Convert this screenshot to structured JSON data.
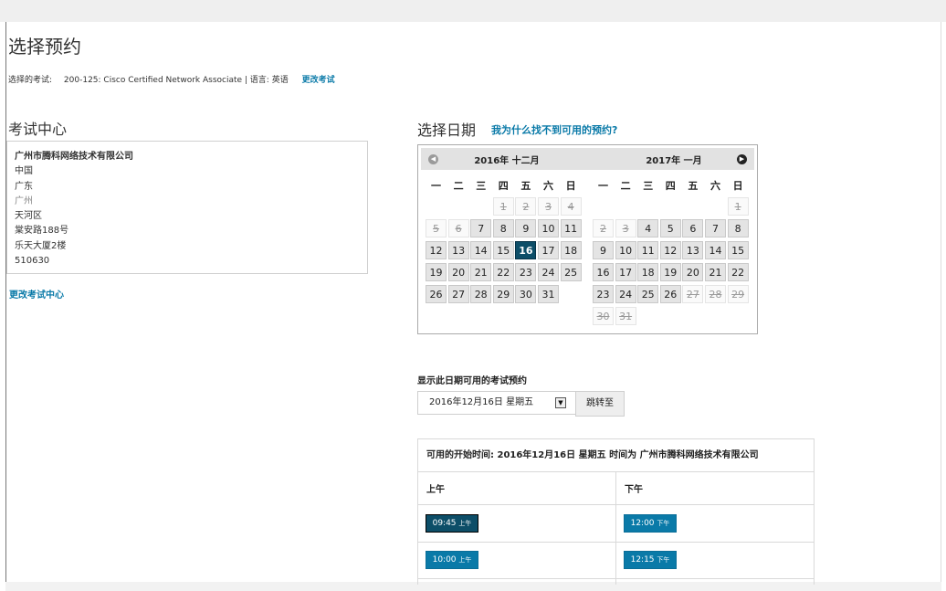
{
  "page": {
    "title": "选择预约"
  },
  "exam": {
    "label": "选择的考试:",
    "value": "200-125: Cisco Certified Network Associate | 语言: 英语",
    "change_link": "更改考试"
  },
  "center": {
    "title": "考试中心",
    "name": "广州市腾科网络技术有限公司",
    "country": "中国",
    "province": "广东",
    "city": "广州",
    "district": "天河区",
    "street": "棠安路188号",
    "building": "乐天大厦2楼",
    "postal": "510630",
    "change_link": "更改考试中心"
  },
  "calendar": {
    "title": "选择日期",
    "why_link": "我为什么找不到可用的预约?",
    "weekdays": [
      "一",
      "二",
      "三",
      "四",
      "五",
      "六",
      "日"
    ],
    "months": [
      {
        "title": "2016年 十二月",
        "days": [
          {
            "d": "1",
            "r": 0,
            "c": 3,
            "s": "dis"
          },
          {
            "d": "2",
            "r": 0,
            "c": 4,
            "s": "dis"
          },
          {
            "d": "3",
            "r": 0,
            "c": 5,
            "s": "dis"
          },
          {
            "d": "4",
            "r": 0,
            "c": 6,
            "s": "dis"
          },
          {
            "d": "5",
            "r": 1,
            "c": 0,
            "s": "dis"
          },
          {
            "d": "6",
            "r": 1,
            "c": 1,
            "s": "dis"
          },
          {
            "d": "7",
            "r": 1,
            "c": 2,
            "s": "av"
          },
          {
            "d": "8",
            "r": 1,
            "c": 3,
            "s": "av"
          },
          {
            "d": "9",
            "r": 1,
            "c": 4,
            "s": "av"
          },
          {
            "d": "10",
            "r": 1,
            "c": 5,
            "s": "av"
          },
          {
            "d": "11",
            "r": 1,
            "c": 6,
            "s": "av"
          },
          {
            "d": "12",
            "r": 2,
            "c": 0,
            "s": "av"
          },
          {
            "d": "13",
            "r": 2,
            "c": 1,
            "s": "av"
          },
          {
            "d": "14",
            "r": 2,
            "c": 2,
            "s": "av"
          },
          {
            "d": "15",
            "r": 2,
            "c": 3,
            "s": "av"
          },
          {
            "d": "16",
            "r": 2,
            "c": 4,
            "s": "sel"
          },
          {
            "d": "17",
            "r": 2,
            "c": 5,
            "s": "av"
          },
          {
            "d": "18",
            "r": 2,
            "c": 6,
            "s": "av"
          },
          {
            "d": "19",
            "r": 3,
            "c": 0,
            "s": "av"
          },
          {
            "d": "20",
            "r": 3,
            "c": 1,
            "s": "av"
          },
          {
            "d": "21",
            "r": 3,
            "c": 2,
            "s": "av"
          },
          {
            "d": "22",
            "r": 3,
            "c": 3,
            "s": "av"
          },
          {
            "d": "23",
            "r": 3,
            "c": 4,
            "s": "av"
          },
          {
            "d": "24",
            "r": 3,
            "c": 5,
            "s": "av"
          },
          {
            "d": "25",
            "r": 3,
            "c": 6,
            "s": "av"
          },
          {
            "d": "26",
            "r": 4,
            "c": 0,
            "s": "av"
          },
          {
            "d": "27",
            "r": 4,
            "c": 1,
            "s": "av"
          },
          {
            "d": "28",
            "r": 4,
            "c": 2,
            "s": "av"
          },
          {
            "d": "29",
            "r": 4,
            "c": 3,
            "s": "av"
          },
          {
            "d": "30",
            "r": 4,
            "c": 4,
            "s": "av"
          },
          {
            "d": "31",
            "r": 4,
            "c": 5,
            "s": "av"
          }
        ]
      },
      {
        "title": "2017年 一月",
        "days": [
          {
            "d": "1",
            "r": 0,
            "c": 6,
            "s": "dis"
          },
          {
            "d": "2",
            "r": 1,
            "c": 0,
            "s": "dis"
          },
          {
            "d": "3",
            "r": 1,
            "c": 1,
            "s": "dis"
          },
          {
            "d": "4",
            "r": 1,
            "c": 2,
            "s": "av"
          },
          {
            "d": "5",
            "r": 1,
            "c": 3,
            "s": "av"
          },
          {
            "d": "6",
            "r": 1,
            "c": 4,
            "s": "av"
          },
          {
            "d": "7",
            "r": 1,
            "c": 5,
            "s": "av"
          },
          {
            "d": "8",
            "r": 1,
            "c": 6,
            "s": "av"
          },
          {
            "d": "9",
            "r": 2,
            "c": 0,
            "s": "av"
          },
          {
            "d": "10",
            "r": 2,
            "c": 1,
            "s": "av"
          },
          {
            "d": "11",
            "r": 2,
            "c": 2,
            "s": "av"
          },
          {
            "d": "12",
            "r": 2,
            "c": 3,
            "s": "av"
          },
          {
            "d": "13",
            "r": 2,
            "c": 4,
            "s": "av"
          },
          {
            "d": "14",
            "r": 2,
            "c": 5,
            "s": "av"
          },
          {
            "d": "15",
            "r": 2,
            "c": 6,
            "s": "av"
          },
          {
            "d": "16",
            "r": 3,
            "c": 0,
            "s": "av"
          },
          {
            "d": "17",
            "r": 3,
            "c": 1,
            "s": "av"
          },
          {
            "d": "18",
            "r": 3,
            "c": 2,
            "s": "av"
          },
          {
            "d": "19",
            "r": 3,
            "c": 3,
            "s": "av"
          },
          {
            "d": "20",
            "r": 3,
            "c": 4,
            "s": "av"
          },
          {
            "d": "21",
            "r": 3,
            "c": 5,
            "s": "av"
          },
          {
            "d": "22",
            "r": 3,
            "c": 6,
            "s": "av"
          },
          {
            "d": "23",
            "r": 4,
            "c": 0,
            "s": "av"
          },
          {
            "d": "24",
            "r": 4,
            "c": 1,
            "s": "av"
          },
          {
            "d": "25",
            "r": 4,
            "c": 2,
            "s": "av"
          },
          {
            "d": "26",
            "r": 4,
            "c": 3,
            "s": "av"
          },
          {
            "d": "27",
            "r": 4,
            "c": 4,
            "s": "dis"
          },
          {
            "d": "28",
            "r": 4,
            "c": 5,
            "s": "dis"
          },
          {
            "d": "29",
            "r": 4,
            "c": 6,
            "s": "dis"
          },
          {
            "d": "30",
            "r": 5,
            "c": 0,
            "s": "dis"
          },
          {
            "d": "31",
            "r": 5,
            "c": 1,
            "s": "dis"
          }
        ]
      }
    ]
  },
  "appointments": {
    "label": "显示此日期可用的考试预约",
    "selected_date": "2016年12月16日 星期五",
    "jump_button": "跳转至",
    "header": "可用的开始时间: 2016年12月16日 星期五 时间为 广州市腾科网络技术有限公司",
    "morning": {
      "label": "上午",
      "slots": [
        {
          "time": "09:45",
          "period": "上午",
          "selected": true
        },
        {
          "time": "10:00",
          "period": "上午",
          "selected": false
        }
      ]
    },
    "afternoon": {
      "label": "下午",
      "slots": [
        {
          "time": "12:00",
          "period": "下午",
          "selected": false
        },
        {
          "time": "12:15",
          "period": "下午",
          "selected": false
        }
      ]
    }
  },
  "colors": {
    "accent": "#0a7aa8",
    "selected": "#0d4e68"
  }
}
